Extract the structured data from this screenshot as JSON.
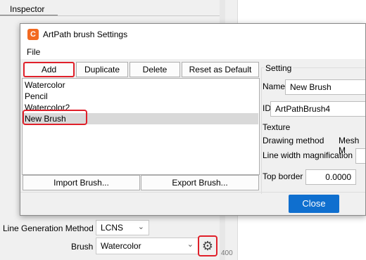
{
  "inspector": {
    "tab_label": "Inspector",
    "line_generation_label": "Line Generation Method",
    "line_generation_value": "LCNS",
    "brush_label": "Brush",
    "brush_value": "Watercolor",
    "ruler_value": "400",
    "gear_icon": "gear-icon"
  },
  "dialog": {
    "title": "ArtPath brush Settings",
    "app_icon_glyph": "C",
    "menu": [
      "File"
    ],
    "buttons": {
      "add": "Add",
      "duplicate": "Duplicate",
      "delete": "Delete",
      "reset": "Reset as Default",
      "import": "Import Brush...",
      "export": "Export Brush...",
      "close": "Close"
    },
    "brushes": [
      "Watercolor",
      "Pencil",
      "Watercolor2",
      "New Brush"
    ],
    "selected_brush": "New Brush",
    "setting": {
      "group_title": "Setting",
      "name_label": "Name",
      "name_value": "New Brush",
      "id_label": "ID",
      "id_value": "ArtPathBrush4",
      "texture_label": "Texture",
      "drawing_method_label": "Drawing method",
      "mesh_label": "Mesh M",
      "line_width_label": "Line width magnification",
      "top_border_label": "Top border",
      "top_border_value": "0.0000"
    }
  },
  "colors": {
    "highlight": "#e0202a",
    "primary_button": "#0f6fcf",
    "app_icon": "#f26a21"
  }
}
